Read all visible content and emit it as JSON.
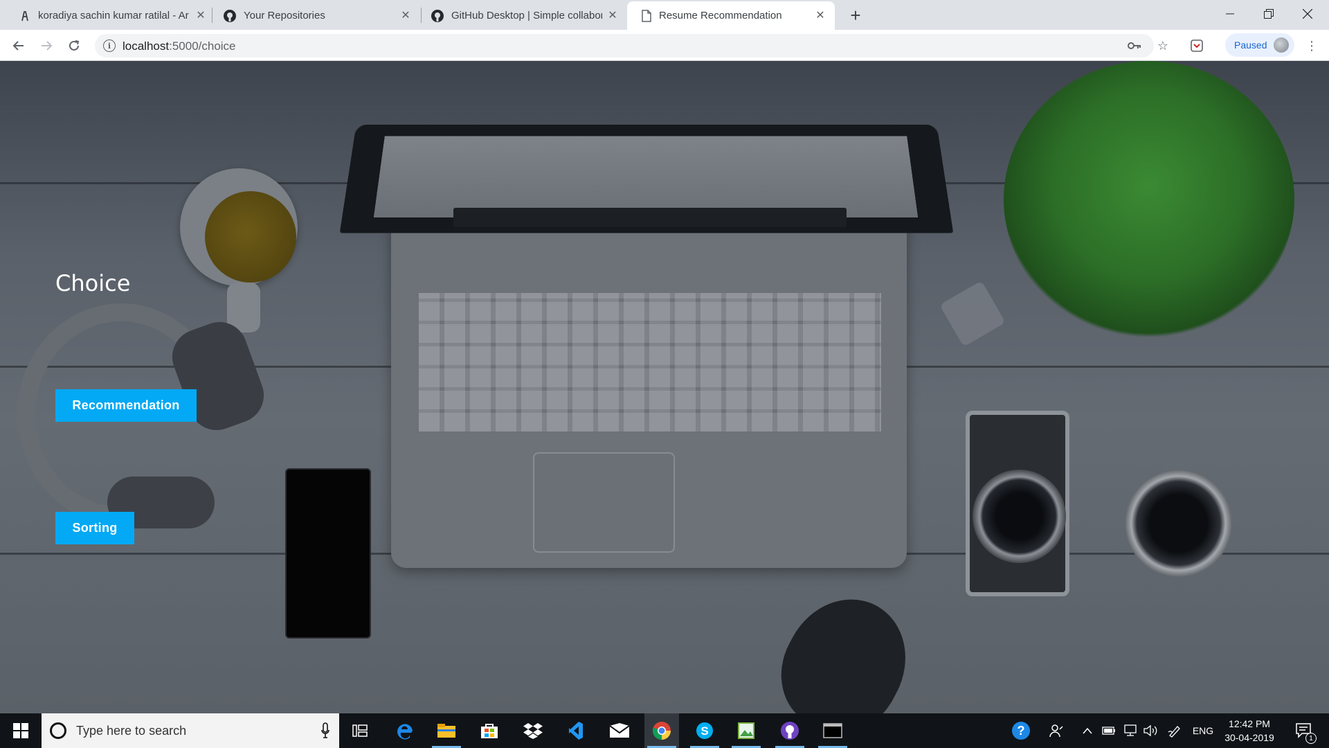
{
  "browser": {
    "tabs": [
      {
        "title": "koradiya sachin kumar ratilal - Ar",
        "icon": "ar-favicon-icon",
        "active": false
      },
      {
        "title": "Your Repositories",
        "icon": "github-icon",
        "active": false
      },
      {
        "title": "GitHub Desktop | Simple collabor",
        "icon": "github-icon",
        "active": false
      },
      {
        "title": "Resume Recommendation",
        "icon": "document-icon",
        "active": true
      }
    ],
    "url_host": "localhost",
    "url_rest": ":5000/choice",
    "profile_label": "Paused"
  },
  "page": {
    "title": "Choice",
    "buttons": {
      "recommendation": "Recommendation",
      "sorting": "Sorting"
    },
    "accent_color": "#03a9f4"
  },
  "taskbar": {
    "search_placeholder": "Type here to search",
    "apps": [
      "task-view-icon",
      "edge-icon",
      "file-explorer-icon",
      "store-icon",
      "dropbox-icon",
      "visual-studio-icon",
      "mail-icon",
      "chrome-icon",
      "skype-icon",
      "image-editor-icon",
      "github-desktop-icon",
      "terminal-icon"
    ],
    "language": "ENG",
    "time": "12:42 PM",
    "date": "30-04-2019",
    "notification_count": "1"
  }
}
